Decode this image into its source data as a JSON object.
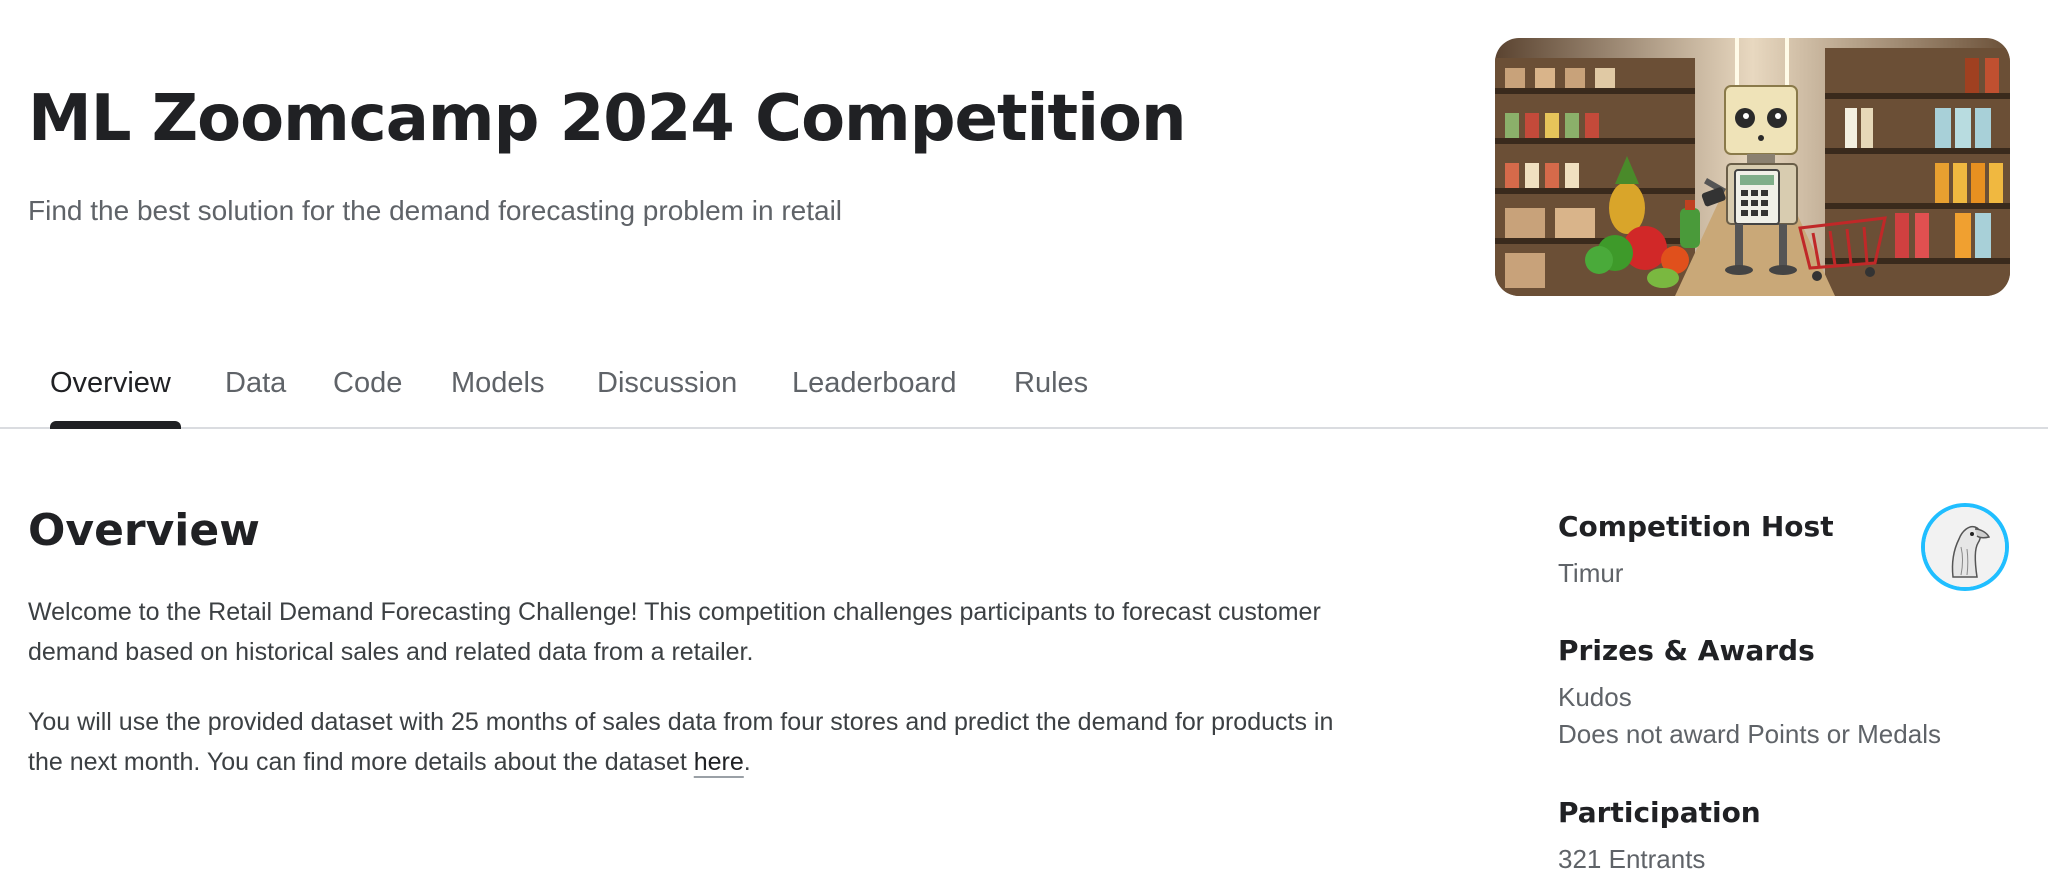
{
  "header": {
    "title": "ML Zoomcamp 2024 Competition",
    "subtitle": "Find the best solution for the demand forecasting problem in retail",
    "banner_icon": "robot-shopping-banner"
  },
  "tabs": [
    {
      "label": "Overview",
      "active": true
    },
    {
      "label": "Data",
      "active": false
    },
    {
      "label": "Code",
      "active": false
    },
    {
      "label": "Models",
      "active": false
    },
    {
      "label": "Discussion",
      "active": false
    },
    {
      "label": "Leaderboard",
      "active": false
    },
    {
      "label": "Rules",
      "active": false
    }
  ],
  "overview": {
    "heading": "Overview",
    "paragraph_1": "Welcome to the Retail Demand Forecasting Challenge! This competition challenges participants to forecast customer demand based on historical sales and related data from a retailer.",
    "paragraph_2_before_link": "You will use the provided dataset with 25 months of sales data from four stores and predict the demand for products in the next month. You can find more details about the dataset ",
    "paragraph_2_link": "here",
    "paragraph_2_after_link": "."
  },
  "sidebar": {
    "host_label": "Competition Host",
    "host_name": "Timur",
    "prizes_label": "Prizes & Awards",
    "prize_line_1": "Kudos",
    "prize_line_2": "Does not award Points or Medals",
    "participation_label": "Participation",
    "participation_value": "321 Entrants"
  },
  "colors": {
    "text_primary": "#202124",
    "text_secondary": "#5f6368",
    "avatar_ring": "#20beff",
    "divider": "#dadce0"
  }
}
